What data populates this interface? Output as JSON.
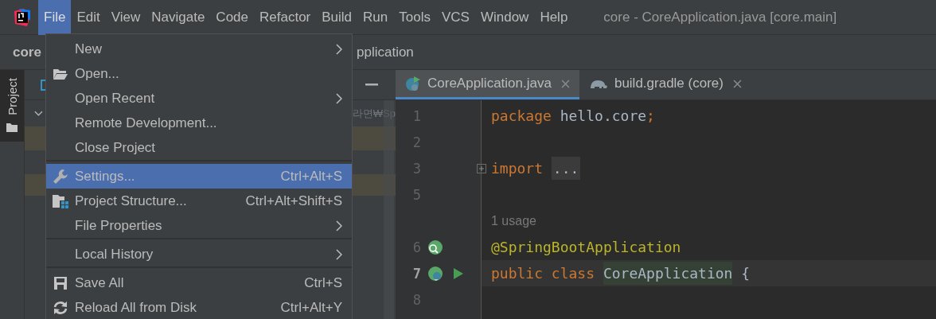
{
  "menu_bar": [
    {
      "label": "File",
      "selected": true
    },
    {
      "label": "Edit",
      "selected": false
    },
    {
      "label": "View",
      "selected": false
    },
    {
      "label": "Navigate",
      "selected": false
    },
    {
      "label": "Code",
      "selected": false
    },
    {
      "label": "Refactor",
      "selected": false
    },
    {
      "label": "Build",
      "selected": false
    },
    {
      "label": "Run",
      "selected": false
    },
    {
      "label": "Tools",
      "selected": false
    },
    {
      "label": "VCS",
      "selected": false
    },
    {
      "label": "Window",
      "selected": false
    },
    {
      "label": "Help",
      "selected": false
    }
  ],
  "window": {
    "title": "core - CoreApplication.java [core.main]"
  },
  "breadcrumb": {
    "project": "core",
    "file": "pplication"
  },
  "tool_strip": {
    "label": "Project",
    "selected": true
  },
  "project_panel": {
    "row_text": "라면₩Sp"
  },
  "file_menu": [
    {
      "kind": "item",
      "label": "New",
      "submenu": true,
      "selected": false
    },
    {
      "kind": "item",
      "label": "Open...",
      "submenu": false,
      "selected": false
    },
    {
      "kind": "item",
      "label": "Open Recent",
      "submenu": true,
      "selected": false
    },
    {
      "kind": "item",
      "label": "Remote Development...",
      "submenu": false,
      "selected": false
    },
    {
      "kind": "item",
      "label": "Close Project",
      "submenu": false,
      "selected": false
    },
    {
      "kind": "separator"
    },
    {
      "kind": "item",
      "label": "Settings...",
      "shortcut": "Ctrl+Alt+S",
      "submenu": false,
      "selected": true
    },
    {
      "kind": "item",
      "label": "Project Structure...",
      "shortcut": "Ctrl+Alt+Shift+S",
      "submenu": false,
      "selected": false
    },
    {
      "kind": "item",
      "label": "File Properties",
      "submenu": true,
      "selected": false
    },
    {
      "kind": "separator"
    },
    {
      "kind": "item",
      "label": "Local History",
      "submenu": true,
      "selected": false
    },
    {
      "kind": "separator"
    },
    {
      "kind": "item",
      "label": "Save All",
      "shortcut": "Ctrl+S",
      "submenu": false,
      "selected": false
    },
    {
      "kind": "item",
      "label": "Reload All from Disk",
      "shortcut": "Ctrl+Alt+Y",
      "submenu": false,
      "selected": false
    }
  ],
  "editor_tabs": [
    {
      "label": "CoreApplication.java",
      "selected": true
    },
    {
      "label": "build.gradle (core)",
      "selected": false
    }
  ],
  "code_lines": [
    {
      "kind": "code",
      "number": "1",
      "current": false,
      "tokens": [
        {
          "kind": "keyword",
          "text": "package"
        },
        {
          "kind": "plain",
          "text": " hello.core"
        },
        {
          "kind": "keyword",
          "text": ";"
        }
      ]
    },
    {
      "kind": "code",
      "number": "2",
      "current": false
    },
    {
      "kind": "code",
      "number": "3",
      "current": false,
      "tokens": [
        {
          "kind": "keyword",
          "text": "import"
        },
        {
          "kind": "folded",
          "text": "..."
        }
      ]
    },
    {
      "kind": "code",
      "number": "5",
      "current": false
    },
    {
      "kind": "hint",
      "text": "1 usage"
    },
    {
      "kind": "code",
      "number": "6",
      "current": false,
      "tokens": [
        {
          "kind": "annotation",
          "text": "@SpringBootApplication"
        }
      ]
    },
    {
      "kind": "code",
      "number": "7",
      "current": true,
      "tokens": [
        {
          "kind": "keyword",
          "text": "public class"
        },
        {
          "kind": "highlight",
          "text": "CoreApplication"
        },
        {
          "kind": "plain",
          "text": " {"
        }
      ]
    },
    {
      "kind": "code",
      "number": "8",
      "current": false
    }
  ]
}
